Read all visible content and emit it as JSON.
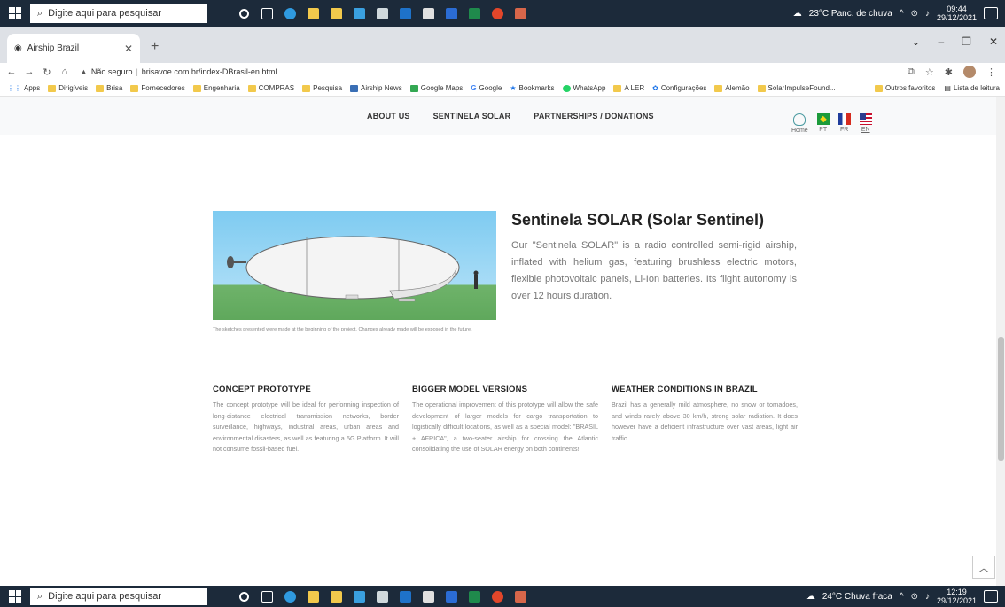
{
  "taskbar_top": {
    "search_placeholder": "Digite aqui para pesquisar",
    "weather": "23°C  Panc. de chuva",
    "time": "09:44",
    "date": "29/12/2021"
  },
  "taskbar_bottom": {
    "search_placeholder": "Digite aqui para pesquisar",
    "weather": "24°C  Chuva fraca",
    "time": "12:19",
    "date": "29/12/2021"
  },
  "browser": {
    "tab_title": "Airship Brazil",
    "security_label": "Não seguro",
    "url": "brisavoe.com.br/index-DBrasil-en.html",
    "bookmarks": [
      "Apps",
      "Dirigíveis",
      "Brisa",
      "Fornecedores",
      "Engenharia",
      "COMPRAS",
      "Pesquisa",
      "Airship News",
      "Google Maps",
      "Google",
      "Bookmarks",
      "WhatsApp",
      "A LER",
      "Configurações",
      "Alemão",
      "SolarImpulseFound..."
    ],
    "bookmarks_right": [
      "Outros favoritos",
      "Lista de leitura"
    ]
  },
  "site_nav": {
    "links": [
      "ABOUT US",
      "SENTINELA SOLAR",
      "PARTNERSHIPS / DONATIONS"
    ],
    "home_label": "Home",
    "pt_label": "PT",
    "fr_label": "FR",
    "en_label": "EN"
  },
  "hero": {
    "caption": "The sketches presented were made at the beginning of the project. Changes already made will be exposed in the future.",
    "title": "Sentinela SOLAR (Solar Sentinel)",
    "description": "Our \"Sentinela SOLAR\" is a radio controlled semi-rigid airship, inflated with helium gas, featuring brushless electric motors, flexible photovoltaic panels, Li-Ion batteries. Its flight autonomy is over 12 hours duration."
  },
  "columns": [
    {
      "heading": "CONCEPT PROTOTYPE",
      "text": "The concept prototype will be ideal for performing inspection of long-distance electrical transmission networks, border surveillance, highways, industrial areas, urban areas and environmental disasters, as well as featuring a 5G Platform. It will not consume fossil-based fuel."
    },
    {
      "heading": "BIGGER MODEL VERSIONS",
      "text": "The operational improvement of this prototype will allow the safe development of larger models for cargo transportation to logistically difficult locations, as well as a special model: \"BRASIL + AFRICA\", a two-seater airship for crossing the Atlantic consolidating the use of SOLAR energy on both continents!"
    },
    {
      "heading": "WEATHER CONDITIONS IN BRAZIL",
      "text": "Brazil has a generally mild atmosphere, no snow or tornadoes, and winds rarely above 30 km/h, strong solar radiation. It does however have a deficient infrastructure over vast areas, light air traffic."
    }
  ],
  "colors": {
    "taskbar": "#1c2a3a",
    "sky": "#7ecbf1",
    "grass": "#6fb36a"
  }
}
